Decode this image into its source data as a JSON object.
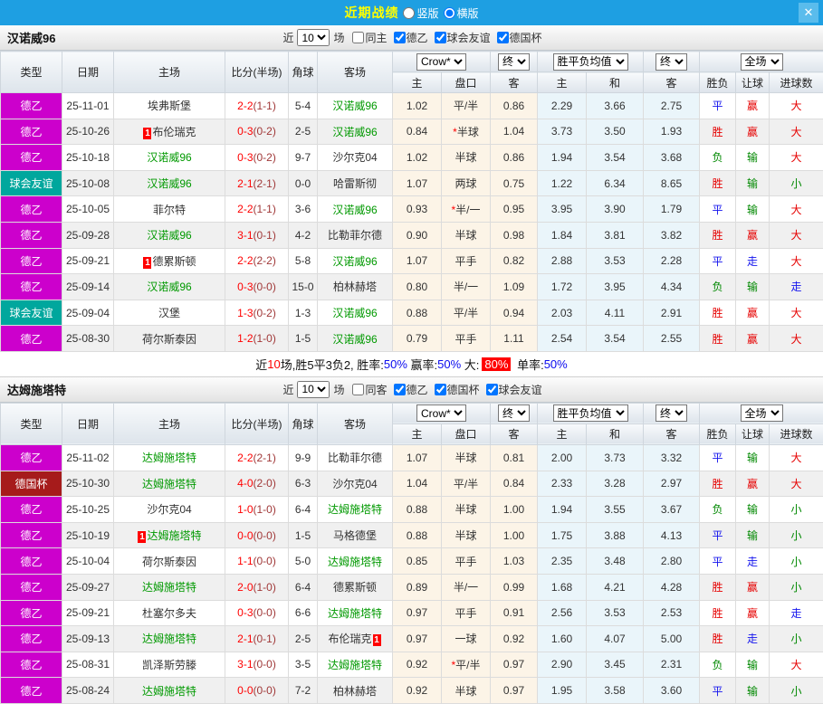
{
  "titlebar": {
    "title": "近期战绩",
    "vertical": "竖版",
    "horizontal": "横版",
    "selected": "横版",
    "close_icon": "✕"
  },
  "header": {
    "columns": [
      "类型",
      "日期",
      "主场",
      "比分(半场)",
      "角球",
      "客场"
    ],
    "subcolumns": [
      "主",
      "盘口",
      "客",
      "主",
      "和",
      "客",
      "胜负",
      "让球",
      "进球数"
    ],
    "dropdowns": {
      "company": "Crow*",
      "time": "终",
      "wdl_avg": "胜平负均值",
      "full": "全场"
    }
  },
  "colors": {
    "league": {
      "德乙": "#CC00CC",
      "球会友谊": "#00A79D",
      "德国杯": "#A61B1B"
    },
    "accent_titlebar": "#1E9FE2",
    "result_red": "#E60000",
    "result_blue": "#1414EE",
    "result_green": "#008800"
  },
  "sections": [
    {
      "team": "汉诺威96",
      "filter": {
        "near": "近",
        "count": "10",
        "games": "场",
        "same": {
          "label": "同主",
          "checked": false
        },
        "leagues": [
          {
            "label": "德乙",
            "checked": true
          },
          {
            "label": "球会友谊",
            "checked": true
          },
          {
            "label": "德国杯",
            "checked": true
          }
        ]
      },
      "rows": [
        {
          "league": "德乙",
          "date": "25-11-01",
          "home": {
            "name": "埃弗斯堡",
            "active": false,
            "card": null
          },
          "score": "2-2",
          "half": "(1-1)",
          "corners": "5-4",
          "away": {
            "name": "汉诺威96",
            "active": true,
            "card": null
          },
          "odds": [
            "1.02",
            "平/半",
            "0.86"
          ],
          "handicap_star": false,
          "avg": [
            "2.29",
            "3.66",
            "2.75"
          ],
          "results": [
            [
              "平",
              "blue"
            ],
            [
              "赢",
              "red"
            ],
            [
              "大",
              "red"
            ]
          ]
        },
        {
          "league": "德乙",
          "date": "25-10-26",
          "home": {
            "name": "布伦瑞克",
            "active": false,
            "card": "before"
          },
          "score": "0-3",
          "half": "(0-2)",
          "corners": "2-5",
          "away": {
            "name": "汉诺威96",
            "active": true,
            "card": null
          },
          "odds": [
            "0.84",
            "半球",
            "1.04"
          ],
          "handicap_star": true,
          "avg": [
            "3.73",
            "3.50",
            "1.93"
          ],
          "results": [
            [
              "胜",
              "red"
            ],
            [
              "赢",
              "red"
            ],
            [
              "大",
              "red"
            ]
          ]
        },
        {
          "league": "德乙",
          "date": "25-10-18",
          "home": {
            "name": "汉诺威96",
            "active": true,
            "card": null
          },
          "score": "0-3",
          "half": "(0-2)",
          "corners": "9-7",
          "away": {
            "name": "沙尔克04",
            "active": false,
            "card": null
          },
          "odds": [
            "1.02",
            "半球",
            "0.86"
          ],
          "handicap_star": false,
          "avg": [
            "1.94",
            "3.54",
            "3.68"
          ],
          "results": [
            [
              "负",
              "green"
            ],
            [
              "输",
              "green"
            ],
            [
              "大",
              "red"
            ]
          ]
        },
        {
          "league": "球会友谊",
          "date": "25-10-08",
          "home": {
            "name": "汉诺威96",
            "active": true,
            "card": null
          },
          "score": "2-1",
          "half": "(2-1)",
          "corners": "0-0",
          "away": {
            "name": "哈雷斯彻",
            "active": false,
            "card": null
          },
          "odds": [
            "1.07",
            "两球",
            "0.75"
          ],
          "handicap_star": false,
          "avg": [
            "1.22",
            "6.34",
            "8.65"
          ],
          "results": [
            [
              "胜",
              "red"
            ],
            [
              "输",
              "green"
            ],
            [
              "小",
              "green"
            ]
          ]
        },
        {
          "league": "德乙",
          "date": "25-10-05",
          "home": {
            "name": "菲尔特",
            "active": false,
            "card": null
          },
          "score": "2-2",
          "half": "(1-1)",
          "corners": "3-6",
          "away": {
            "name": "汉诺威96",
            "active": true,
            "card": null
          },
          "odds": [
            "0.93",
            "半/一",
            "0.95"
          ],
          "handicap_star": true,
          "avg": [
            "3.95",
            "3.90",
            "1.79"
          ],
          "results": [
            [
              "平",
              "blue"
            ],
            [
              "输",
              "green"
            ],
            [
              "大",
              "red"
            ]
          ]
        },
        {
          "league": "德乙",
          "date": "25-09-28",
          "home": {
            "name": "汉诺威96",
            "active": true,
            "card": null
          },
          "score": "3-1",
          "half": "(0-1)",
          "corners": "4-2",
          "away": {
            "name": "比勒菲尔德",
            "active": false,
            "card": null
          },
          "odds": [
            "0.90",
            "半球",
            "0.98"
          ],
          "handicap_star": false,
          "avg": [
            "1.84",
            "3.81",
            "3.82"
          ],
          "results": [
            [
              "胜",
              "red"
            ],
            [
              "赢",
              "red"
            ],
            [
              "大",
              "red"
            ]
          ]
        },
        {
          "league": "德乙",
          "date": "25-09-21",
          "home": {
            "name": "德累斯顿",
            "active": false,
            "card": "before"
          },
          "score": "2-2",
          "half": "(2-2)",
          "corners": "5-8",
          "away": {
            "name": "汉诺威96",
            "active": true,
            "card": null
          },
          "odds": [
            "1.07",
            "平手",
            "0.82"
          ],
          "handicap_star": false,
          "avg": [
            "2.88",
            "3.53",
            "2.28"
          ],
          "results": [
            [
              "平",
              "blue"
            ],
            [
              "走",
              "blue"
            ],
            [
              "大",
              "red"
            ]
          ]
        },
        {
          "league": "德乙",
          "date": "25-09-14",
          "home": {
            "name": "汉诺威96",
            "active": true,
            "card": null
          },
          "score": "0-3",
          "half": "(0-0)",
          "corners": "15-0",
          "away": {
            "name": "柏林赫塔",
            "active": false,
            "card": null
          },
          "odds": [
            "0.80",
            "半/一",
            "1.09"
          ],
          "handicap_star": false,
          "avg": [
            "1.72",
            "3.95",
            "4.34"
          ],
          "results": [
            [
              "负",
              "green"
            ],
            [
              "输",
              "green"
            ],
            [
              "走",
              "blue"
            ]
          ]
        },
        {
          "league": "球会友谊",
          "date": "25-09-04",
          "home": {
            "name": "汉堡",
            "active": false,
            "card": null
          },
          "score": "1-3",
          "half": "(0-2)",
          "corners": "1-3",
          "away": {
            "name": "汉诺威96",
            "active": true,
            "card": null
          },
          "odds": [
            "0.88",
            "平/半",
            "0.94"
          ],
          "handicap_star": false,
          "avg": [
            "2.03",
            "4.11",
            "2.91"
          ],
          "results": [
            [
              "胜",
              "red"
            ],
            [
              "赢",
              "red"
            ],
            [
              "大",
              "red"
            ]
          ]
        },
        {
          "league": "德乙",
          "date": "25-08-30",
          "home": {
            "name": "荷尔斯泰因",
            "active": false,
            "card": null
          },
          "score": "1-2",
          "half": "(1-0)",
          "corners": "1-5",
          "away": {
            "name": "汉诺威96",
            "active": true,
            "card": null
          },
          "odds": [
            "0.79",
            "平手",
            "1.11"
          ],
          "handicap_star": false,
          "avg": [
            "2.54",
            "3.54",
            "2.55"
          ],
          "results": [
            [
              "胜",
              "red"
            ],
            [
              "赢",
              "red"
            ],
            [
              "大",
              "red"
            ]
          ]
        }
      ],
      "summary": [
        [
          "近",
          "k"
        ],
        [
          "10",
          "r"
        ],
        [
          "场,胜5平3负2, 胜率:",
          "k"
        ],
        [
          "50%",
          "b"
        ],
        [
          " 赢率:",
          "k"
        ],
        [
          "50%",
          "b"
        ],
        [
          " 大:",
          "k"
        ],
        [
          "80%",
          "badge"
        ],
        [
          " 单率:",
          "k"
        ],
        [
          "50%",
          "b"
        ]
      ]
    },
    {
      "team": "达姆施塔特",
      "filter": {
        "near": "近",
        "count": "10",
        "games": "场",
        "same": {
          "label": "同客",
          "checked": false
        },
        "leagues": [
          {
            "label": "德乙",
            "checked": true
          },
          {
            "label": "德国杯",
            "checked": true
          },
          {
            "label": "球会友谊",
            "checked": true
          }
        ]
      },
      "rows": [
        {
          "league": "德乙",
          "date": "25-11-02",
          "home": {
            "name": "达姆施塔特",
            "active": true,
            "card": null
          },
          "score": "2-2",
          "half": "(2-1)",
          "corners": "9-9",
          "away": {
            "name": "比勒菲尔德",
            "active": false,
            "card": null
          },
          "odds": [
            "1.07",
            "半球",
            "0.81"
          ],
          "handicap_star": false,
          "avg": [
            "2.00",
            "3.73",
            "3.32"
          ],
          "results": [
            [
              "平",
              "blue"
            ],
            [
              "输",
              "green"
            ],
            [
              "大",
              "red"
            ]
          ]
        },
        {
          "league": "德国杯",
          "date": "25-10-30",
          "home": {
            "name": "达姆施塔特",
            "active": true,
            "card": null
          },
          "score": "4-0",
          "half": "(2-0)",
          "corners": "6-3",
          "away": {
            "name": "沙尔克04",
            "active": false,
            "card": null
          },
          "odds": [
            "1.04",
            "平/半",
            "0.84"
          ],
          "handicap_star": false,
          "avg": [
            "2.33",
            "3.28",
            "2.97"
          ],
          "results": [
            [
              "胜",
              "red"
            ],
            [
              "赢",
              "red"
            ],
            [
              "大",
              "red"
            ]
          ]
        },
        {
          "league": "德乙",
          "date": "25-10-25",
          "home": {
            "name": "沙尔克04",
            "active": false,
            "card": null
          },
          "score": "1-0",
          "half": "(1-0)",
          "corners": "6-4",
          "away": {
            "name": "达姆施塔特",
            "active": true,
            "card": null
          },
          "odds": [
            "0.88",
            "半球",
            "1.00"
          ],
          "handicap_star": false,
          "avg": [
            "1.94",
            "3.55",
            "3.67"
          ],
          "results": [
            [
              "负",
              "green"
            ],
            [
              "输",
              "green"
            ],
            [
              "小",
              "green"
            ]
          ]
        },
        {
          "league": "德乙",
          "date": "25-10-19",
          "home": {
            "name": "达姆施塔特",
            "active": true,
            "card": "before"
          },
          "score": "0-0",
          "half": "(0-0)",
          "corners": "1-5",
          "away": {
            "name": "马格德堡",
            "active": false,
            "card": null
          },
          "odds": [
            "0.88",
            "半球",
            "1.00"
          ],
          "handicap_star": false,
          "avg": [
            "1.75",
            "3.88",
            "4.13"
          ],
          "results": [
            [
              "平",
              "blue"
            ],
            [
              "输",
              "green"
            ],
            [
              "小",
              "green"
            ]
          ]
        },
        {
          "league": "德乙",
          "date": "25-10-04",
          "home": {
            "name": "荷尔斯泰因",
            "active": false,
            "card": null
          },
          "score": "1-1",
          "half": "(0-0)",
          "corners": "5-0",
          "away": {
            "name": "达姆施塔特",
            "active": true,
            "card": null
          },
          "odds": [
            "0.85",
            "平手",
            "1.03"
          ],
          "handicap_star": false,
          "avg": [
            "2.35",
            "3.48",
            "2.80"
          ],
          "results": [
            [
              "平",
              "blue"
            ],
            [
              "走",
              "blue"
            ],
            [
              "小",
              "green"
            ]
          ]
        },
        {
          "league": "德乙",
          "date": "25-09-27",
          "home": {
            "name": "达姆施塔特",
            "active": true,
            "card": null
          },
          "score": "2-0",
          "half": "(1-0)",
          "corners": "6-4",
          "away": {
            "name": "德累斯顿",
            "active": false,
            "card": null
          },
          "odds": [
            "0.89",
            "半/一",
            "0.99"
          ],
          "handicap_star": false,
          "avg": [
            "1.68",
            "4.21",
            "4.28"
          ],
          "results": [
            [
              "胜",
              "red"
            ],
            [
              "赢",
              "red"
            ],
            [
              "小",
              "green"
            ]
          ]
        },
        {
          "league": "德乙",
          "date": "25-09-21",
          "home": {
            "name": "杜塞尔多夫",
            "active": false,
            "card": null
          },
          "score": "0-3",
          "half": "(0-0)",
          "corners": "6-6",
          "away": {
            "name": "达姆施塔特",
            "active": true,
            "card": null
          },
          "odds": [
            "0.97",
            "平手",
            "0.91"
          ],
          "handicap_star": false,
          "avg": [
            "2.56",
            "3.53",
            "2.53"
          ],
          "results": [
            [
              "胜",
              "red"
            ],
            [
              "赢",
              "red"
            ],
            [
              "走",
              "blue"
            ]
          ]
        },
        {
          "league": "德乙",
          "date": "25-09-13",
          "home": {
            "name": "达姆施塔特",
            "active": true,
            "card": null
          },
          "score": "2-1",
          "half": "(0-1)",
          "corners": "2-5",
          "away": {
            "name": "布伦瑞克",
            "active": false,
            "card": "after"
          },
          "odds": [
            "0.97",
            "一球",
            "0.92"
          ],
          "handicap_star": false,
          "avg": [
            "1.60",
            "4.07",
            "5.00"
          ],
          "results": [
            [
              "胜",
              "red"
            ],
            [
              "走",
              "blue"
            ],
            [
              "小",
              "green"
            ]
          ]
        },
        {
          "league": "德乙",
          "date": "25-08-31",
          "home": {
            "name": "凯泽斯劳滕",
            "active": false,
            "card": null
          },
          "score": "3-1",
          "half": "(0-0)",
          "corners": "3-5",
          "away": {
            "name": "达姆施塔特",
            "active": true,
            "card": null
          },
          "odds": [
            "0.92",
            "平/半",
            "0.97"
          ],
          "handicap_star": true,
          "avg": [
            "2.90",
            "3.45",
            "2.31"
          ],
          "results": [
            [
              "负",
              "green"
            ],
            [
              "输",
              "green"
            ],
            [
              "大",
              "red"
            ]
          ]
        },
        {
          "league": "德乙",
          "date": "25-08-24",
          "home": {
            "name": "达姆施塔特",
            "active": true,
            "card": null
          },
          "score": "0-0",
          "half": "(0-0)",
          "corners": "7-2",
          "away": {
            "name": "柏林赫塔",
            "active": false,
            "card": null
          },
          "odds": [
            "0.92",
            "半球",
            "0.97"
          ],
          "handicap_star": false,
          "avg": [
            "1.95",
            "3.58",
            "3.60"
          ],
          "results": [
            [
              "平",
              "blue"
            ],
            [
              "输",
              "green"
            ],
            [
              "小",
              "green"
            ]
          ]
        }
      ],
      "summary": null
    }
  ]
}
